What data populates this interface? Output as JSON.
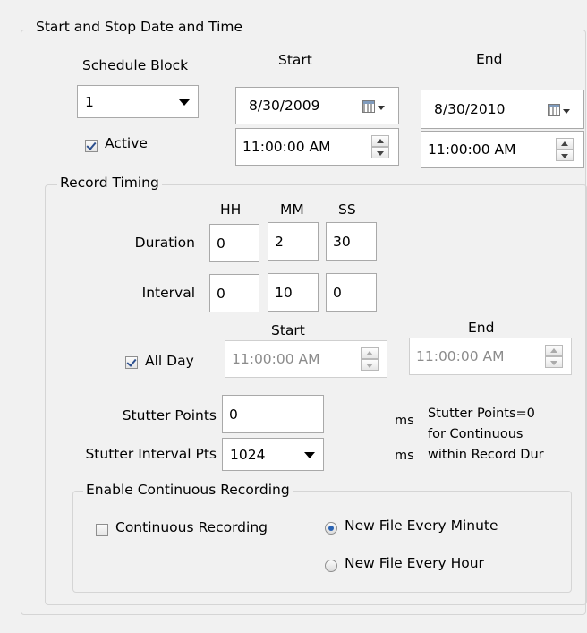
{
  "colors": {
    "background": "#f1f1f1",
    "group_border": "#d5d5d5",
    "field_border": "#a9a9a9",
    "check_mark": "#2c4f8e",
    "radio_dot": "#2a63b3"
  },
  "start_stop": {
    "legend": "Start and Stop Date and Time",
    "schedule_block_label": "Schedule Block",
    "start_header": "Start",
    "end_header": "End",
    "schedule_block_value": "1",
    "start_date": "8/30/2009",
    "end_date": "8/30/2010",
    "active_label": "Active",
    "active_checked": true,
    "start_time": "11:00:00 AM",
    "end_time": "11:00:00 AM"
  },
  "record_timing": {
    "legend": "Record Timing",
    "headers": {
      "hh": "HH",
      "mm": "MM",
      "ss": "SS"
    },
    "duration_label": "Duration",
    "duration": {
      "hh": "0",
      "mm": "2",
      "ss": "30"
    },
    "interval_label": "Interval",
    "interval": {
      "hh": "0",
      "mm": "10",
      "ss": "0"
    },
    "start_header": "Start",
    "end_header": "End",
    "all_day_label": "All Day",
    "all_day_checked": true,
    "start_time": "11:00:00 AM",
    "end_time": "11:00:00 AM",
    "stutter_points_label": "Stutter Points",
    "stutter_points_value": "0",
    "stutter_interval_label": "Stutter Interval Pts",
    "stutter_interval_value": "1024",
    "unit_ms_1": "ms",
    "unit_ms_2": "ms",
    "stutter_note_line1": "Stutter Points=0",
    "stutter_note_line2": "for Continuous",
    "stutter_note_line3": "within Record Dur"
  },
  "continuous": {
    "legend": "Enable Continuous Recording",
    "continuous_label": "Continuous Recording",
    "continuous_checked": false,
    "radio_minute_label": "New File Every Minute",
    "radio_hour_label": "New File Every Hour",
    "selected": "minute"
  }
}
